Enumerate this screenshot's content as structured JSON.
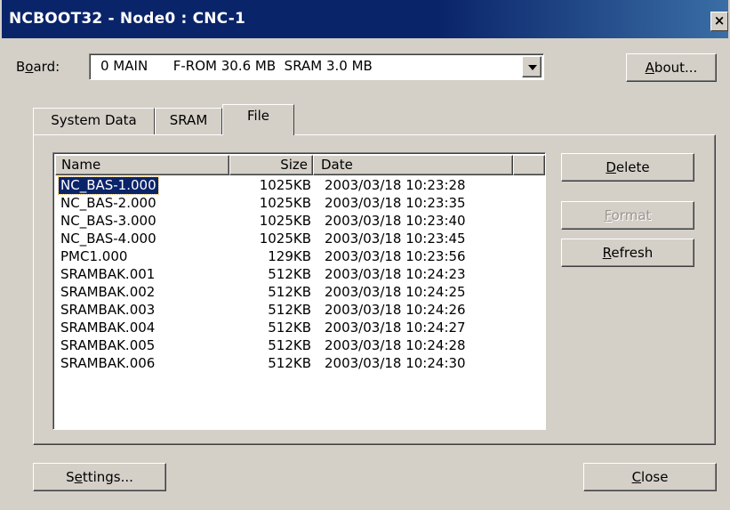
{
  "window": {
    "title": "NCBOOT32 - Node0 : CNC-1",
    "close_label": "×"
  },
  "board": {
    "label_pre": "B",
    "label_ul": "o",
    "label_post": "ard:",
    "value": "0 MAIN      F-ROM 30.6 MB  SRAM 3.0 MB"
  },
  "buttons": {
    "about_ul": "A",
    "about_rest": "bout...",
    "delete_ul": "D",
    "delete_rest": "elete",
    "format_ul": "F",
    "format_rest": "ormat",
    "refresh_ul": "R",
    "refresh_rest": "efresh",
    "settings_pre": "S",
    "settings_ul": "e",
    "settings_rest": "ttings...",
    "close_ul": "C",
    "close_rest": "lose"
  },
  "tabs": [
    "System Data",
    "SRAM",
    "File"
  ],
  "active_tab": "File",
  "list": {
    "columns": [
      "Name",
      "Size",
      "Date"
    ],
    "rows": [
      {
        "name": "NC_BAS-1.000",
        "size": "1025KB",
        "date": "2003/03/18 10:23:28"
      },
      {
        "name": "NC_BAS-2.000",
        "size": "1025KB",
        "date": "2003/03/18 10:23:35"
      },
      {
        "name": "NC_BAS-3.000",
        "size": "1025KB",
        "date": "2003/03/18 10:23:40"
      },
      {
        "name": "NC_BAS-4.000",
        "size": "1025KB",
        "date": "2003/03/18 10:23:45"
      },
      {
        "name": "PMC1.000",
        "size": "129KB",
        "date": "2003/03/18 10:23:56"
      },
      {
        "name": "SRAMBAK.001",
        "size": "512KB",
        "date": "2003/03/18 10:24:23"
      },
      {
        "name": "SRAMBAK.002",
        "size": "512KB",
        "date": "2003/03/18 10:24:25"
      },
      {
        "name": "SRAMBAK.003",
        "size": "512KB",
        "date": "2003/03/18 10:24:26"
      },
      {
        "name": "SRAMBAK.004",
        "size": "512KB",
        "date": "2003/03/18 10:24:27"
      },
      {
        "name": "SRAMBAK.005",
        "size": "512KB",
        "date": "2003/03/18 10:24:28"
      },
      {
        "name": "SRAMBAK.006",
        "size": "512KB",
        "date": "2003/03/18 10:24:30"
      }
    ],
    "selected_index": 0
  },
  "colors": {
    "title_bar": "#0a246a",
    "face": "#d4d0c8",
    "selection": "#0a246a"
  }
}
